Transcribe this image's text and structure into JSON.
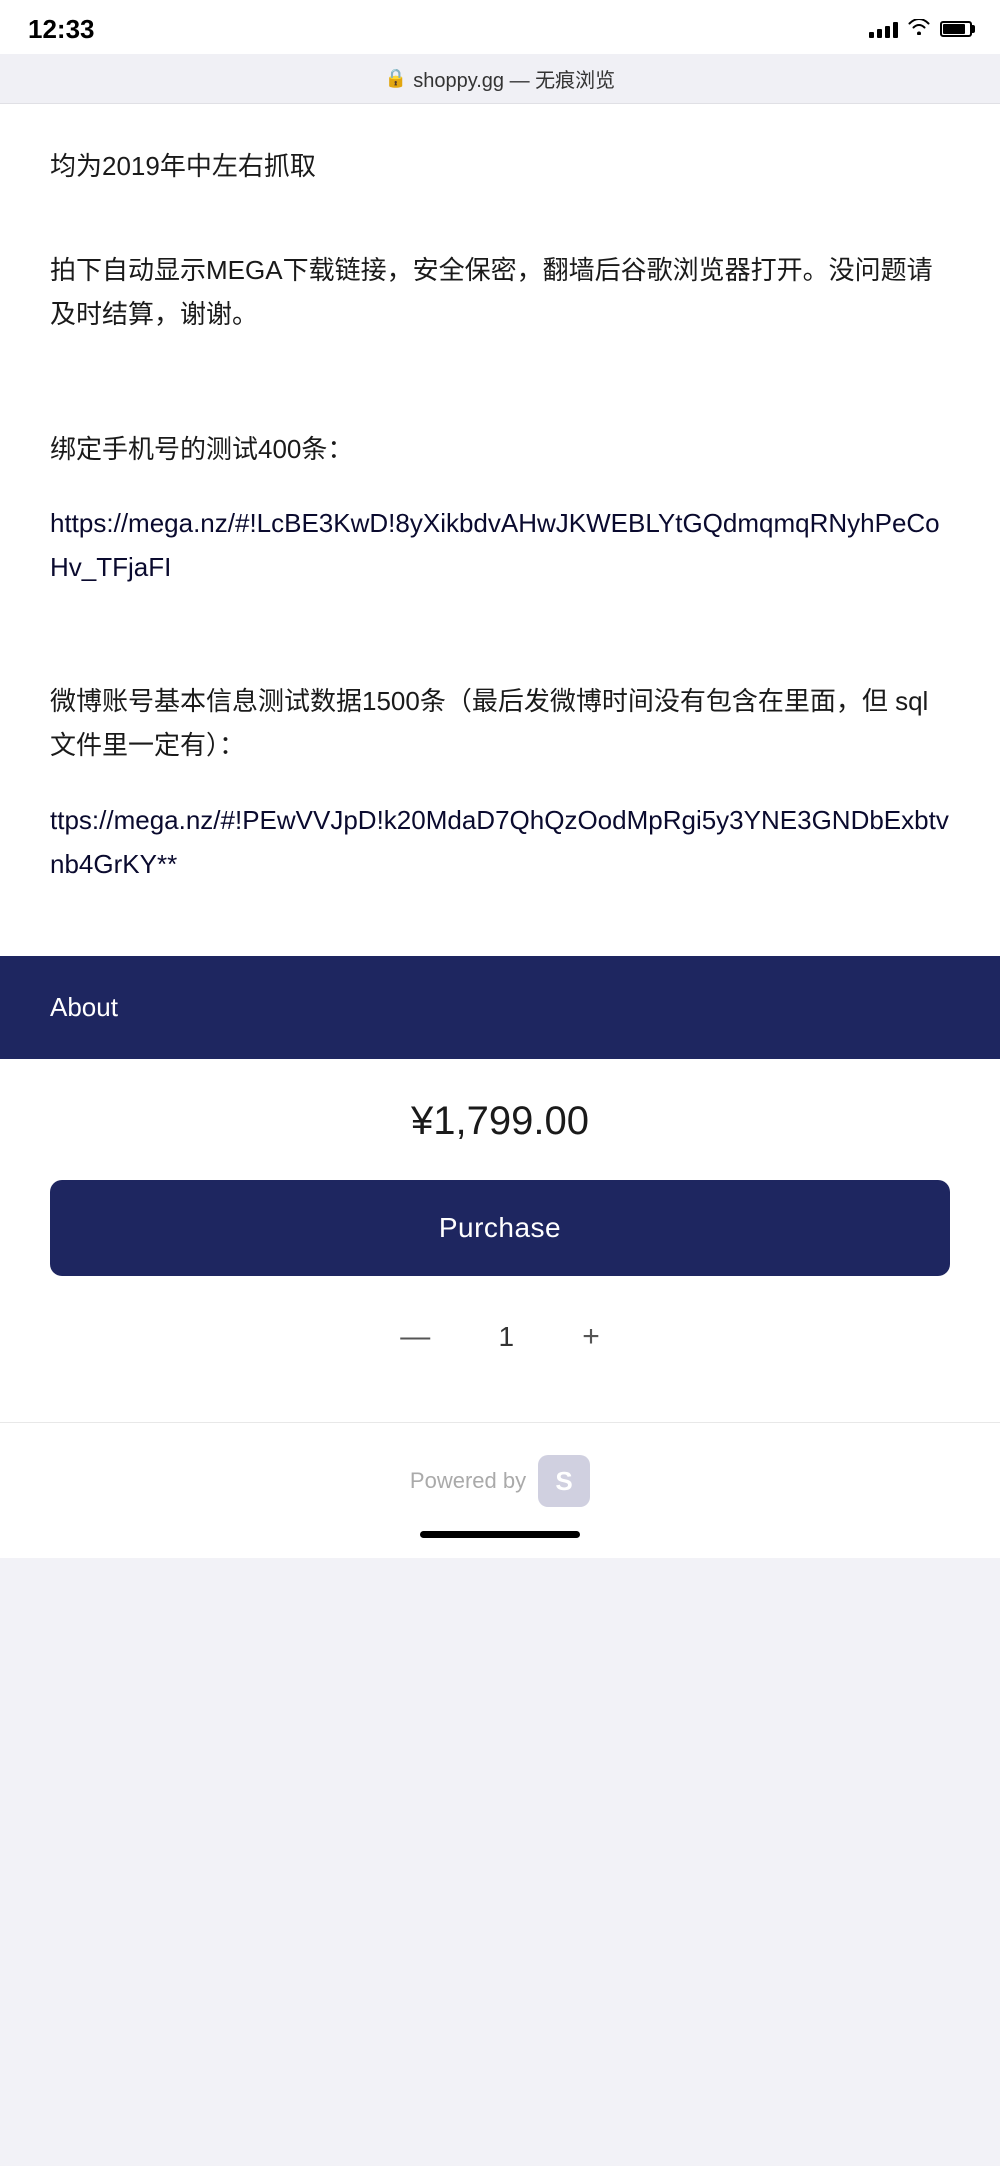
{
  "status_bar": {
    "time": "12:33"
  },
  "browser": {
    "url": "shoppy.gg — 无痕浏览",
    "lock_icon": "🔒"
  },
  "content": {
    "paragraph1": "均为2019年中左右抓取",
    "paragraph2": "拍下自动显示MEGA下载链接，安全保密，翻墙后谷歌浏览器打开。没问题请及时结算，谢谢。",
    "paragraph3": "绑定手机号的测试400条：",
    "link1": "https://mega.nz/#!LcBE3KwD!8yXikbdvAHwJKWEBLYtGQdmqmqRNyhPeCoHv_TFjaFI",
    "paragraph4": "微博账号基本信息测试数据1500条（最后发微博时间没有包含在里面，但 sql 文件里一定有）：",
    "link2": "ttps://mega.nz/#!PEwVVJpD!k20MdaD7QhQzOodMpRgi5y3YNE3GNDbExbtvnb4GrKY**"
  },
  "about": {
    "label": "About"
  },
  "purchase_section": {
    "price": "¥1,799.00",
    "button_label": "Purchase",
    "quantity": "1",
    "minus": "—",
    "plus": "+"
  },
  "footer": {
    "powered_by": "Powered by"
  }
}
